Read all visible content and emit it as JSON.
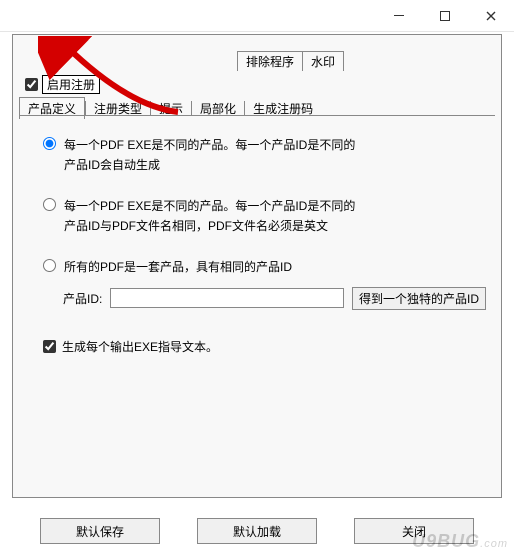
{
  "window": {
    "min_label": "—",
    "max_label": "□",
    "close_label": "✕"
  },
  "top_tabs": {
    "items": [
      "排除程序",
      "水印"
    ]
  },
  "enable": {
    "checked": true,
    "label": "启用注册"
  },
  "sub_tabs": {
    "items": [
      "产品定义",
      "注册类型",
      "提示",
      "局部化",
      "生成注册码"
    ],
    "active_index": 0
  },
  "options": {
    "opt1": {
      "line1": "每一个PDF EXE是不同的产品。每一个产品ID是不同的",
      "line2": "产品ID会自动生成",
      "selected": true
    },
    "opt2": {
      "line1": "每一个PDF EXE是不同的产品。每一个产品ID是不同的",
      "line2": "产品ID与PDF文件名相同，PDF文件名必须是英文",
      "selected": false
    },
    "opt3": {
      "line1": "所有的PDF是一套产品，具有相同的产品ID",
      "selected": false
    },
    "product_id_label": "产品ID:",
    "product_id_value": "",
    "get_id_button": "得到一个独特的产品ID"
  },
  "generate_guide": {
    "checked": true,
    "label": "生成每个输出EXE指导文本。"
  },
  "buttons": {
    "save": "默认保存",
    "load": "默认加载",
    "close": "关闭"
  },
  "watermark": {
    "text": "U9BUG",
    "suffix": ".com"
  }
}
